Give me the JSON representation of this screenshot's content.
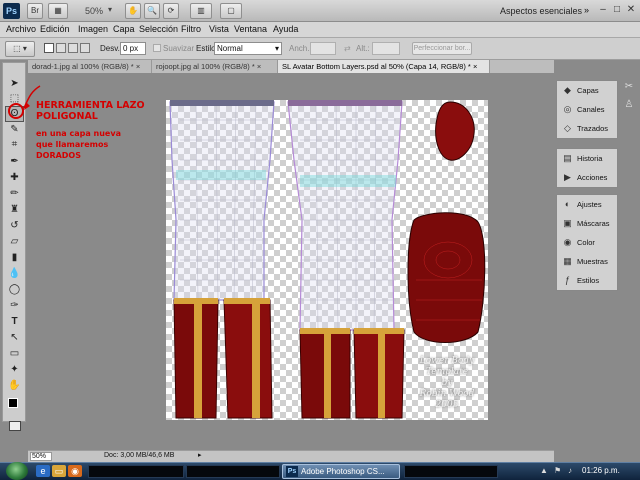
{
  "appbar": {
    "logo": "Ps",
    "br": "Br",
    "zoom": "50%",
    "workspace": "Aspectos esenciales",
    "workspace_arrow": "»",
    "minimize": "–",
    "maximize": "□",
    "close": "✕"
  },
  "menu": [
    "Archivo",
    "Edición",
    "Imagen",
    "Capa",
    "Selección",
    "Filtro",
    "Vista",
    "Ventana",
    "Ayuda"
  ],
  "options": {
    "desv_label": "Desv.:",
    "desv_value": "0 px",
    "suavizar": "Suavizar",
    "estilo_label": "Estilo:",
    "estilo_value": "Normal",
    "anch_label": "Anch.:",
    "alt_label": "Alt.:",
    "refine_button": "Perfeccionar bor..."
  },
  "tabs": [
    {
      "label": "dorad-1.jpg al 100% (RGB/8) *",
      "close": "×"
    },
    {
      "label": "rojoopt.jpg al 100% (RGB/8) *",
      "close": "×"
    },
    {
      "label": "SL Avatar Bottom Layers.psd al 50% (Capa 14, RGB/8) *",
      "close": "×"
    }
  ],
  "annotation": {
    "title_line1": "HERRAMIENTA LAZO",
    "title_line2": "POLIGONAL",
    "desc": [
      "en una capa nueva",
      "que llamaremos",
      "DORADOS"
    ]
  },
  "canvas_text": [
    "Lower Body",
    "Template",
    "by",
    "Robin Wood",
    "2005"
  ],
  "status": {
    "zoom": "50%",
    "doc": "Doc: 3,00 MB/46,6 MB"
  },
  "panels": {
    "group1": [
      {
        "label": "Capas",
        "icon": "layers-icon",
        "glyph": "◆"
      },
      {
        "label": "Canales",
        "icon": "channels-icon",
        "glyph": "◎"
      },
      {
        "label": "Trazados",
        "icon": "paths-icon",
        "glyph": "◇"
      }
    ],
    "group2": [
      {
        "label": "Historia",
        "icon": "history-icon",
        "glyph": "▤"
      },
      {
        "label": "Acciones",
        "icon": "actions-icon",
        "glyph": "▶"
      }
    ],
    "group3": [
      {
        "label": "Ajustes",
        "icon": "adjustments-icon",
        "glyph": "◐"
      },
      {
        "label": "Máscaras",
        "icon": "masks-icon",
        "glyph": "▣"
      },
      {
        "label": "Color",
        "icon": "color-icon",
        "glyph": "◉"
      },
      {
        "label": "Muestras",
        "icon": "swatches-icon",
        "glyph": "▦"
      },
      {
        "label": "Estilos",
        "icon": "styles-icon",
        "glyph": "ƒ"
      }
    ]
  },
  "taskbar": {
    "ps_task": "Adobe Photoshop CS...",
    "ps_icon": "Ps",
    "clock": "01:26 p.m."
  },
  "colors": {
    "annotation": "#d40000",
    "garment_red": "#7a0a0a",
    "gold": "#d6a23a"
  }
}
